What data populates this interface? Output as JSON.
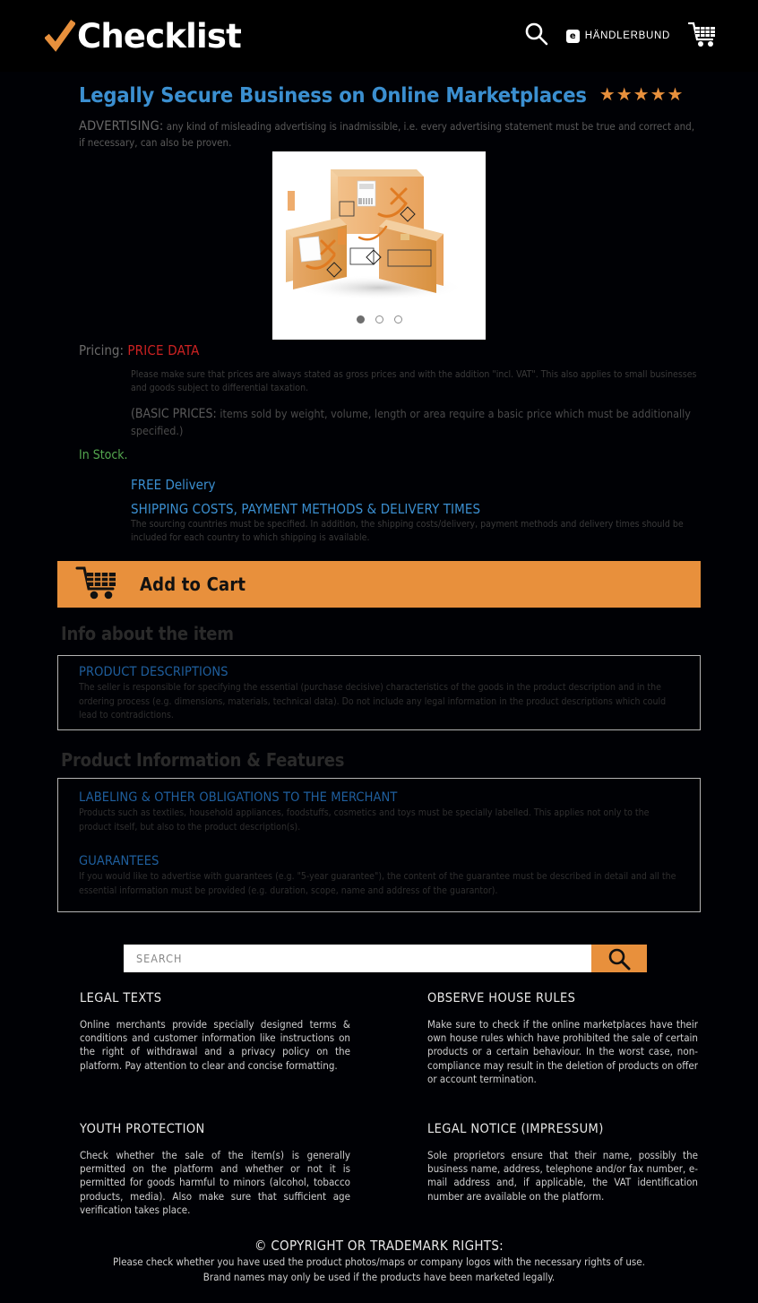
{
  "header": {
    "brand_name": "Checklist",
    "checkmark_icon": "orange-check-icon",
    "search_icon": "search-icon",
    "partner_badge": "e",
    "partner_name": "HÄNDLERBUND",
    "cart_icon": "shopping-cart-icon"
  },
  "product": {
    "title": "Legally Secure Business on Online Marketplaces",
    "rating_stars": 5,
    "star_glyph": "★",
    "advertising_label": "ADVERTISING:",
    "advertising_text": "any kind of misleading advertising is inadmissible, i.e. every advertising statement must be true and correct and, if necessary, can also be proven.",
    "gallery_alt": "three-stacked-cardboard-boxes",
    "carousel_dots": 3,
    "carousel_active": 1
  },
  "pricing": {
    "label": "Pricing:",
    "value": "PRICE DATA",
    "note": "Please make sure that prices are always stated as gross prices and with the addition \"incl. VAT\". This also applies to small businesses and goods subject to differential taxation.",
    "basic_prices_label": "(BASIC PRICES:",
    "basic_prices_text": "items sold by weight, volume, length or area require a basic price which must be additionally specified.)",
    "stock_status": "In Stock.",
    "free_delivery": "FREE Delivery",
    "shipping_head": "SHIPPING COSTS, PAYMENT METHODS & DELIVERY TIMES",
    "shipping_body": "The sourcing countries must be specified. In addition, the shipping costs/delivery, payment methods and delivery times should be included for each country to which shipping is available."
  },
  "cart": {
    "label": "Add to Cart",
    "icon": "shopping-cart-icon"
  },
  "sections": [
    {
      "heading": "Info about the item",
      "blocks": [
        {
          "title": "PRODUCT DESCRIPTIONS",
          "body": "The seller is responsible for specifying the essential (purchase decisive) characteristics of the goods in the product description and in the ordering process (e.g. dimensions, materials, technical data). Do not include any legal information in the product descriptions which could lead to contradictions."
        }
      ]
    },
    {
      "heading": "Product Information & Features",
      "blocks": [
        {
          "title": "LABELING & OTHER OBLIGATIONS TO THE MERCHANT",
          "body": "Products such as textiles, household appliances, foodstuffs, cosmetics and toys must be specially labelled. This applies not only to the product itself, but also to the product description(s)."
        },
        {
          "title": "GUARANTEES",
          "body": "If you would like to advertise with guarantees (e.g. \"5-year guarantee\"), the content of the guarantee must be described in detail and all the essential information must be provided (e.g. duration, scope, name and address of the guarantor)."
        }
      ]
    }
  ],
  "search": {
    "placeholder": "SEARCH",
    "value": "",
    "button_icon": "search-icon"
  },
  "tips": [
    {
      "title": "LEGAL TEXTS",
      "body": "Online merchants provide specially designed terms & conditions and customer information like instructions on the right of withdrawal and a privacy policy on the platform. Pay attention to clear and concise formatting."
    },
    {
      "title": "OBSERVE HOUSE RULES",
      "body": "Make sure to check if the online marketplaces have their own house rules which have prohibited the sale of certain products or a certain behaviour. In the worst case, non-compliance may result in the deletion of products on offer or account termination."
    },
    {
      "title": "YOUTH PROTECTION",
      "body": "Check whether the sale of the item(s) is generally permitted on the platform and whether or not it is permitted for goods harmful to minors (alcohol, tobacco products, media). Also make sure that sufficient age verification takes place."
    },
    {
      "title": "LEGAL NOTICE (IMPRESSUM)",
      "body": "Sole proprietors ensure that their name, possibly the business name, address, telephone and/or fax number, e-mail address and, if applicable, the VAT identification number are available on the platform."
    }
  ],
  "footer": {
    "title": "© COPYRIGHT OR TRADEMARK RIGHTS:",
    "line1": "Please check whether you have used the product photos/maps or company logos with the necessary rights of use.",
    "line2": "Brand names may only be used if the products have been marketed legally."
  },
  "colors": {
    "background": "#000105",
    "accent_orange": "#e8903c",
    "title_blue": "#3b8fd0",
    "heading_blue": "#1f5f9e",
    "price_red": "#cc2222",
    "stock_green": "#54a74f",
    "muted_gray": "#3a3a3a",
    "tip_text": "#cfcfcf"
  }
}
